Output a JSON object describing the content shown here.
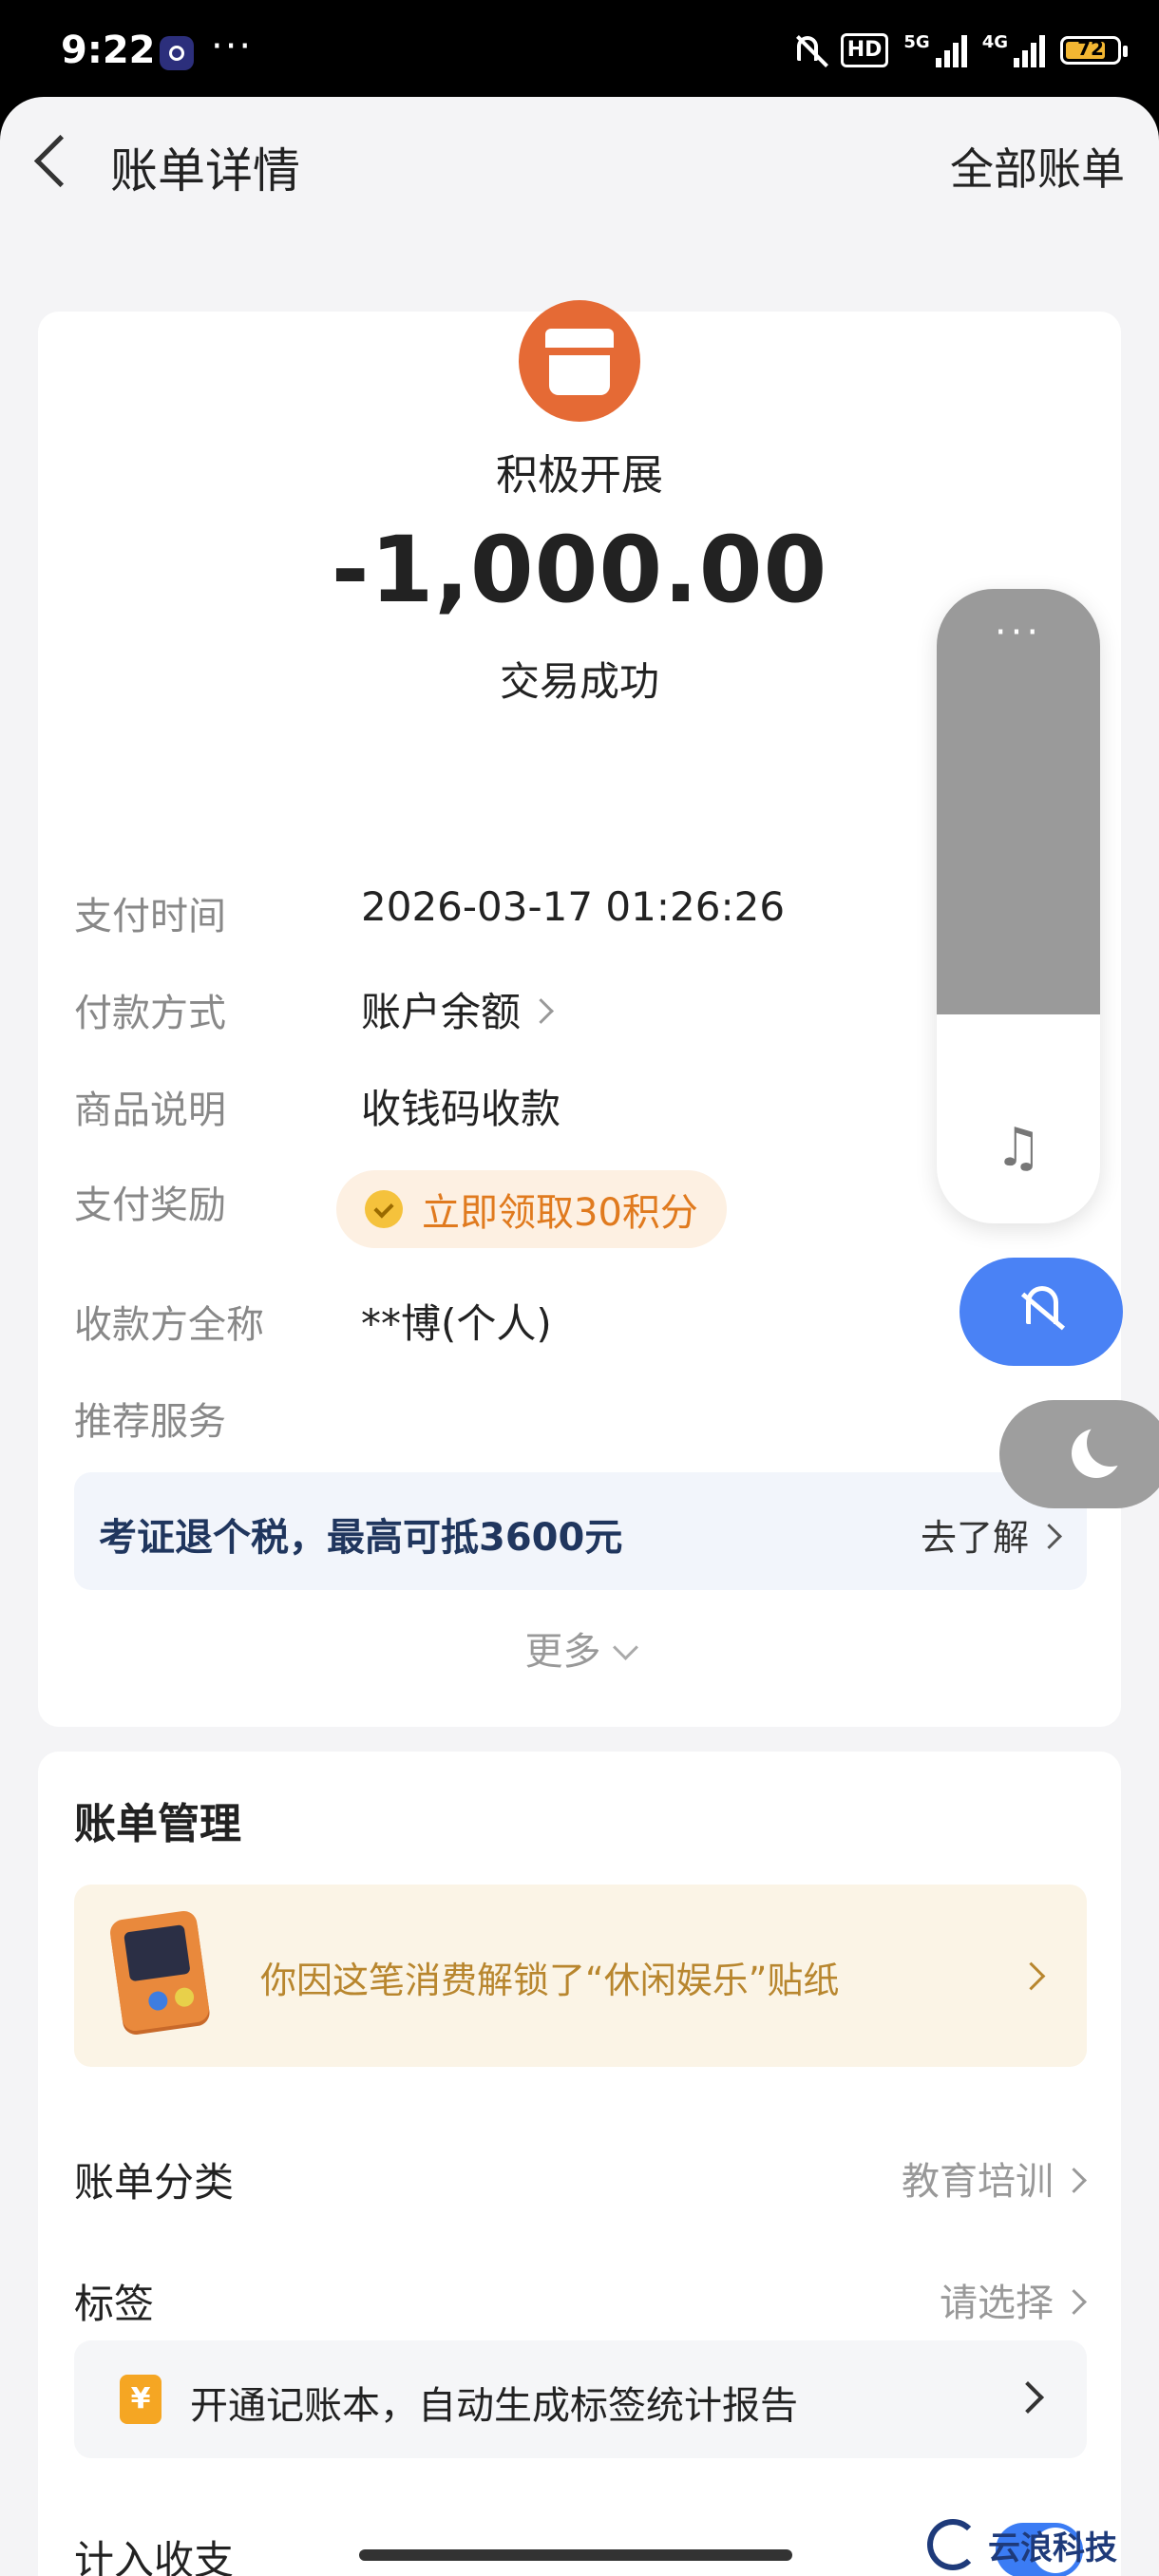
{
  "status_bar": {
    "time": "9:22",
    "dots": "···",
    "hd_label": "HD",
    "network_5g": "5G",
    "network_4g": "4G",
    "battery": "72"
  },
  "nav": {
    "title": "账单详情",
    "all_bills": "全部账单"
  },
  "merchant": {
    "icon": "store-icon",
    "name": "积极开展",
    "amount": "-1,000.00",
    "status": "交易成功"
  },
  "details": {
    "pay_time_label": "支付时间",
    "pay_time_value": "2026-03-17 01:26:26",
    "pay_method_label": "付款方式",
    "pay_method_value": "账户余额",
    "product_label": "商品说明",
    "product_value": "收钱码收款",
    "reward_label": "支付奖励",
    "reward_value": "立即领取30积分",
    "payee_label": "收款方全称",
    "payee_value": "**博(个人)",
    "recommend_label": "推荐服务"
  },
  "promo": {
    "text": "考证退个税，最高可抵3600元",
    "link": "去了解"
  },
  "more_label": "更多",
  "management": {
    "title": "账单管理",
    "sticker_text": "你因这笔消费解锁了“休闲娱乐”贴纸",
    "category_label": "账单分类",
    "category_value": "教育培训",
    "tag_label": "标签",
    "tag_value": "请选择",
    "ledger_icon": "¥",
    "ledger_text": "开通记账本，自动生成标签统计报告",
    "include_label": "计入收支",
    "include_on": true
  },
  "overlay": {
    "volume_dots": "···",
    "music_icon": "♫",
    "volume_level_percent": 67
  },
  "watermark": "云浪科技",
  "colors": {
    "accent_blue": "#3b7cf4",
    "merchant_orange": "#e56a35",
    "reward_orange": "#e07a1e",
    "sticker_gold": "#b8862e"
  }
}
